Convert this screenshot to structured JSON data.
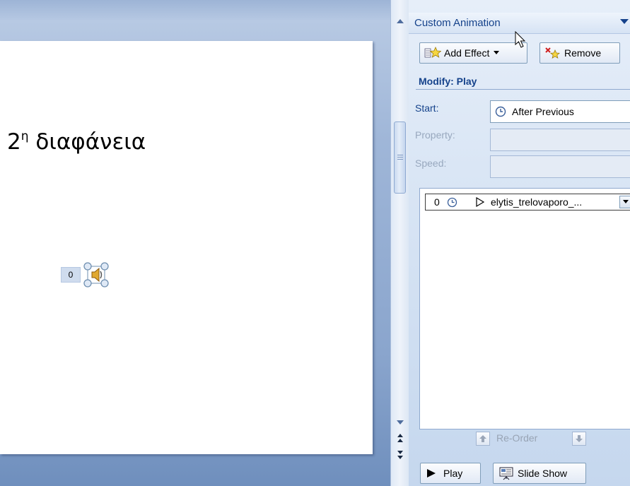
{
  "slide": {
    "title_main": "2",
    "title_sup": "η",
    "title_rest": " διαφάνεια",
    "animation_tag": "0"
  },
  "task_pane": {
    "title": "Custom Animation",
    "add_effect_label": "Add Effect",
    "remove_label": "Remove",
    "modify_title": "Modify: Play",
    "start_label": "Start:",
    "start_value": "After Previous",
    "property_label": "Property:",
    "speed_label": "Speed:",
    "animation_list": [
      {
        "order": "0",
        "name": "elytis_trelovaporo_..."
      }
    ],
    "reorder_label": "Re-Order",
    "play_label": "Play",
    "slideshow_label": "Slide Show"
  },
  "colors": {
    "header_text": "#15428b",
    "workspace_bg": "#6f8fbd",
    "disabled_text": "#98a8be"
  },
  "icons": [
    "star-icon",
    "remove-effect-icon",
    "clock-icon",
    "play-triangle-icon",
    "sound-icon",
    "arrow-up-icon",
    "arrow-down-icon",
    "slideshow-icon",
    "chevron-down-icon",
    "mouse-cursor-icon"
  ]
}
